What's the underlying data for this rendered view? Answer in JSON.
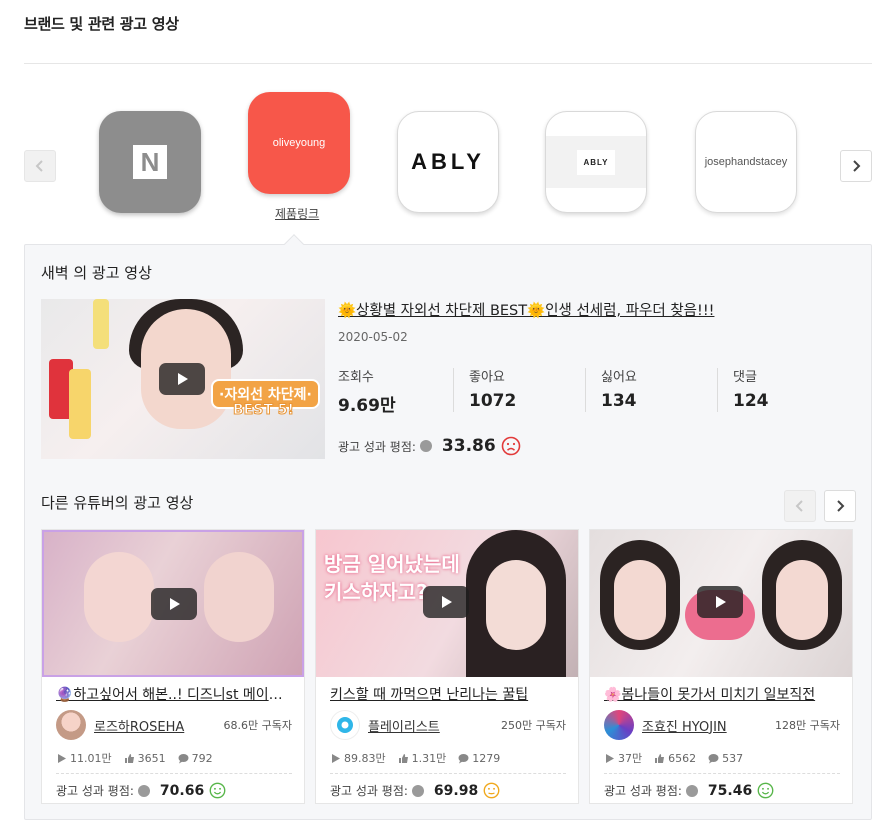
{
  "page": {
    "title": "브랜드 및 관련 광고 영상"
  },
  "carousel": {
    "prev_icon": "chevron-left-icon",
    "next_icon": "chevron-right-icon",
    "brands": [
      {
        "name": "N",
        "logo": "naver-logo"
      },
      {
        "name": "oliveyoung",
        "logo": "oliveyoung-logo"
      },
      {
        "name": "ABLY",
        "logo": "ably-logo"
      },
      {
        "name": "ABLY",
        "logo": "ably-small-logo"
      },
      {
        "name": "josephandstacey",
        "logo": "josephandstacey-logo"
      }
    ],
    "selected_link": "제품링크"
  },
  "featured": {
    "section_title": "새벽 의 광고 영상",
    "video_title": "🌞상황별 자외선 차단제 BEST🌞인생 선세럼, 파우더 찾음!!!",
    "date": "2020-05-02",
    "thumb_badge_line1": "·자외선 차단제·",
    "thumb_badge_line2": "BEST 5!",
    "stats": [
      {
        "label": "조회수",
        "value": "9.69만"
      },
      {
        "label": "좋아요",
        "value": "1072"
      },
      {
        "label": "싫어요",
        "value": "134"
      },
      {
        "label": "댓글",
        "value": "124"
      }
    ],
    "perf_label": "광고 성과 평점:",
    "perf_score": "33.86",
    "perf_icon": "sad-face-icon"
  },
  "others": {
    "section_title": "다른 유튜버의 광고 영상",
    "cards": [
      {
        "title": "🔮하고싶어서 해본..! 디즈니st 메이크업",
        "channel": "로즈하ROSEHA",
        "subscribers": "68.6만 구독자",
        "views": "11.01만",
        "likes": "3651",
        "comments": "792",
        "perf_label": "광고 성과 평점:",
        "perf_score": "70.66",
        "perf_icon": "happy-face-icon"
      },
      {
        "title": "키스할 때 까먹으면 난리나는 꿀팁",
        "channel": "플레이리스트",
        "subscribers": "250만 구독자",
        "views": "89.83만",
        "likes": "1.31만",
        "comments": "1279",
        "perf_label": "광고 성과 평점:",
        "perf_score": "69.98",
        "perf_icon": "neutral-face-icon",
        "thumb_text": "방금 일어났는데 키스하자고?"
      },
      {
        "title": "🌸봄나들이 못가서 미치기 일보직전",
        "channel": "조효진 HYOJIN",
        "subscribers": "128만 구독자",
        "views": "37만",
        "likes": "6562",
        "comments": "537",
        "perf_label": "광고 성과 평점:",
        "perf_score": "75.46",
        "perf_icon": "happy-face-icon"
      }
    ]
  },
  "colors": {
    "sad": "#e23a3a",
    "neutral": "#f0a81c",
    "happy": "#58b64a",
    "panel_bg": "#f6f7f9"
  }
}
